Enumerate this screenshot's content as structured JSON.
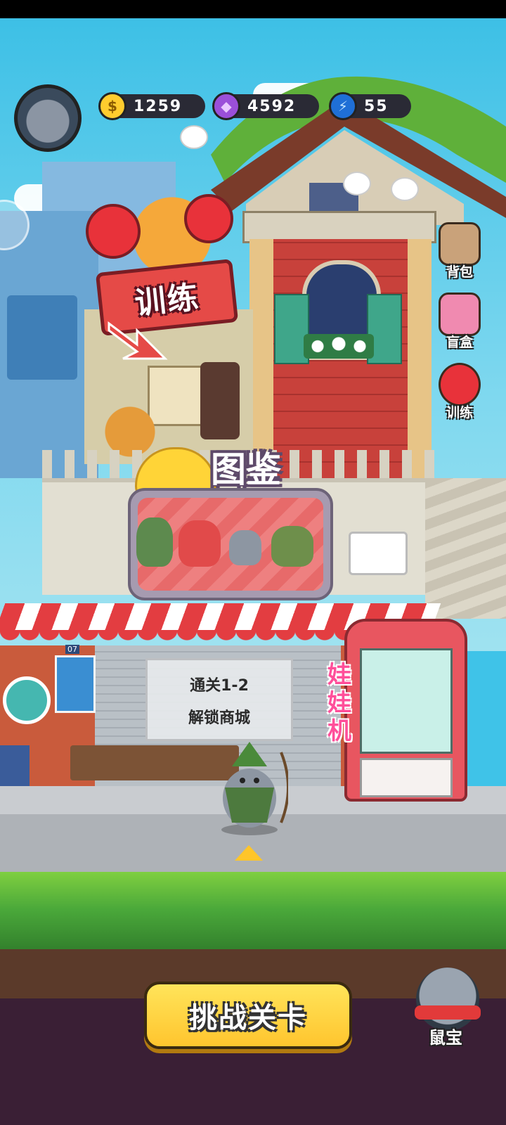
{
  "hud": {
    "coins": "1259",
    "gems": "4592",
    "energy": "55"
  },
  "side_menu": {
    "backpack": "背包",
    "blind_box": "盲盒",
    "training": "训练"
  },
  "training_sign": "训练",
  "collection": {
    "title": "图鉴"
  },
  "shop_lock": {
    "line1": "通关1-2",
    "line2": "解锁商城"
  },
  "claw_machine_label": "娃娃机",
  "poster_code": "07",
  "challenge_button": "挑战关卡",
  "rat_treasure": "鼠宝",
  "colors": {
    "sky": "#3dc0e6",
    "button_yellow": "#ffd43a",
    "accent_red": "#e54a47"
  }
}
